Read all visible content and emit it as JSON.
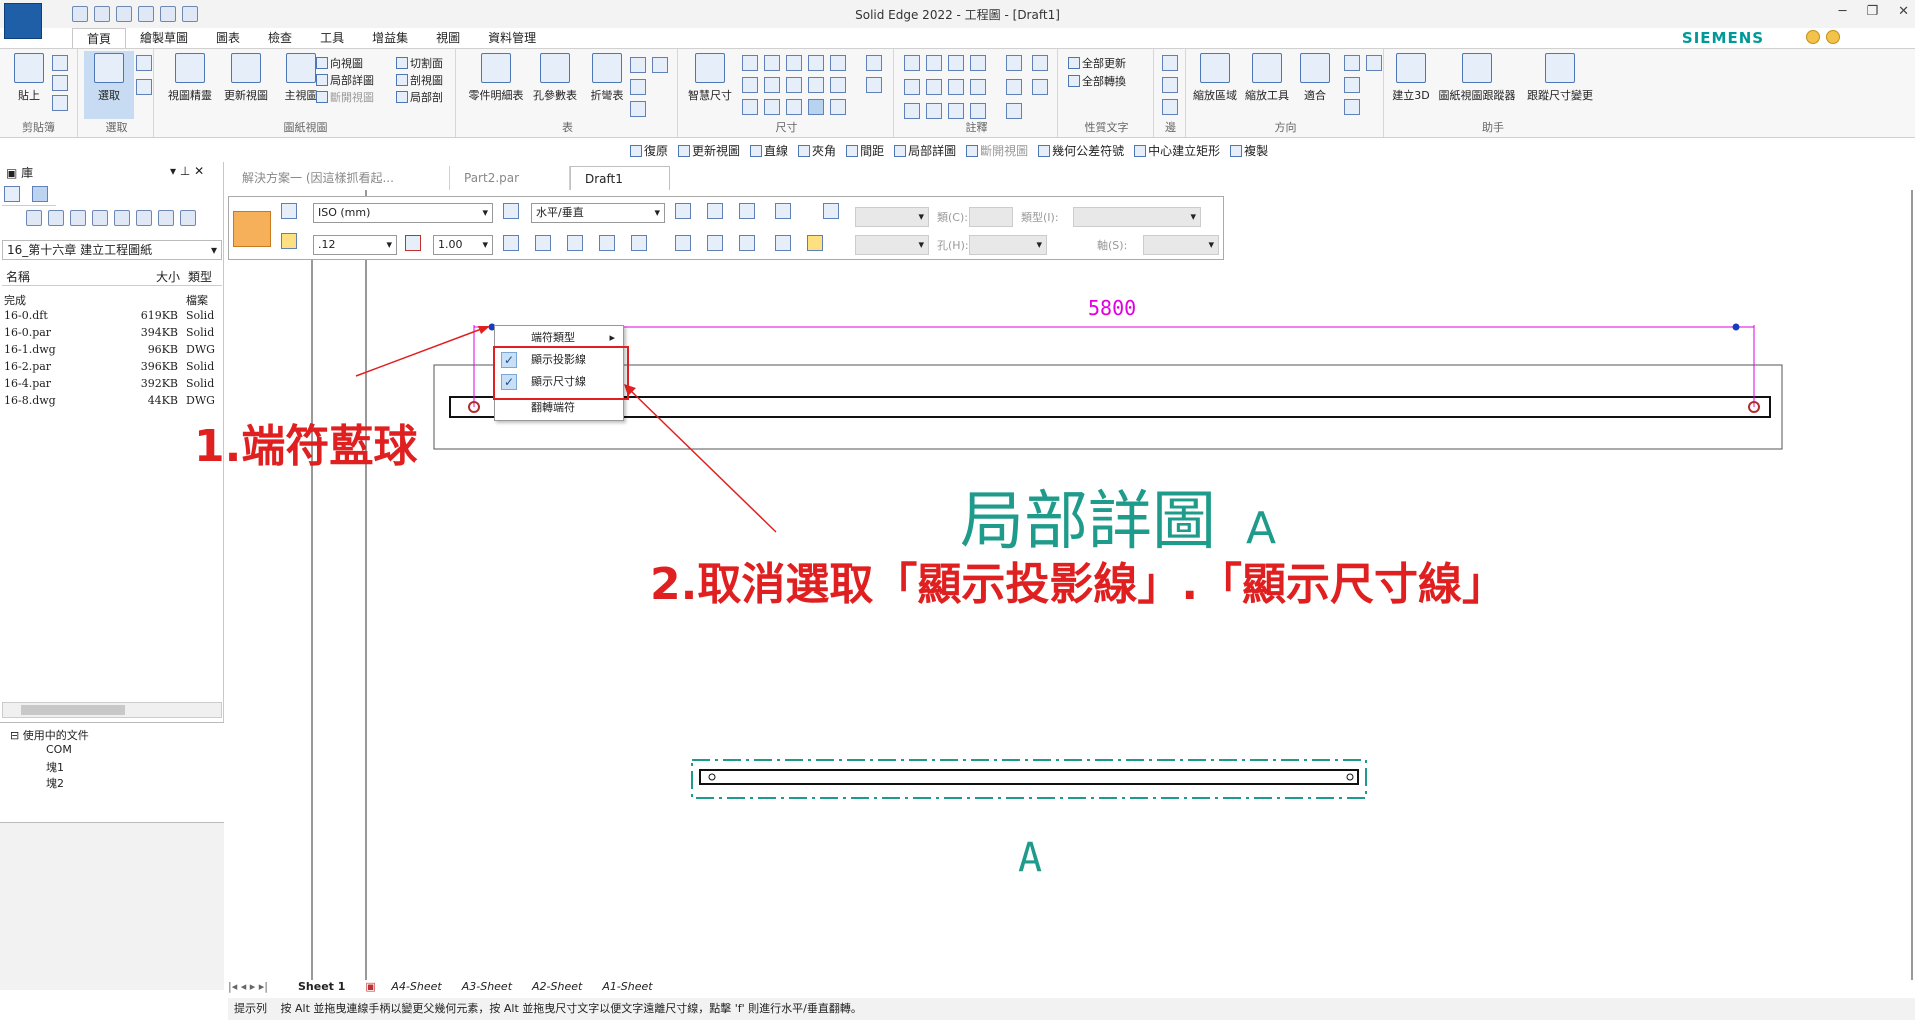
{
  "window": {
    "title": "Solid Edge 2022 - 工程圖 - [Draft1]"
  },
  "menu_tabs": [
    "首頁",
    "繪製草圖",
    "圖表",
    "檢查",
    "工具",
    "增益集",
    "視圖",
    "資料管理"
  ],
  "brand": "SIEMENS",
  "ribbon": {
    "clipboard": {
      "paste": "貼上",
      "label": "剪貼簿"
    },
    "select": {
      "select": "選取",
      "label": "選取"
    },
    "drawing_views": {
      "view_wizard": "視圖精靈",
      "update_views": "更新視圖",
      "principal": "主視圖",
      "projected": "向視圖",
      "detail": "局部詳圖",
      "broken": "斷開視圖",
      "cutting": "切割面",
      "section": "剖視圖",
      "broken_out": "局部剖",
      "label": "圖紙視圖"
    },
    "tables": {
      "parts_list": "零件明細表",
      "hole_table": "孔參數表",
      "bend_table": "折彎表",
      "label": "表"
    },
    "dimension": {
      "smart": "智慧尺寸",
      "label": "尺寸"
    },
    "annotation": {
      "label": "註釋"
    },
    "property_text": {
      "update_all": "全部更新",
      "convert_all": "全部轉換",
      "label": "性質文字"
    },
    "edges": {
      "label": "邊"
    },
    "orient": {
      "zoom_area": "縮放區域",
      "zoom": "縮放工具",
      "fit": "適合",
      "label": "方向"
    },
    "assist": {
      "create3d": "建立3D",
      "view_tracker": "圖紙視圖跟蹤器",
      "dim_tracker": "跟蹤尺寸變更",
      "label": "助手"
    }
  },
  "command_bar": [
    "復原",
    "更新視圖",
    "直線",
    "夾角",
    "間距",
    "局部詳圖",
    "斷開視圖",
    "幾何公差符號",
    "中心建立矩形",
    "複製"
  ],
  "left_pane": {
    "title": "庫",
    "folder": "16_第十六章 建立工程圖紙",
    "headers": {
      "name": "名稱",
      "size": "大小",
      "type": "類型"
    },
    "files": [
      {
        "name": "完成",
        "size": "",
        "type": "檔案"
      },
      {
        "name": "16-0.dft",
        "size": "619KB",
        "type": "Solid"
      },
      {
        "name": "16-0.par",
        "size": "394KB",
        "type": "Solid"
      },
      {
        "name": "16-1.dwg",
        "size": "96KB",
        "type": "DWG"
      },
      {
        "name": "16-2.par",
        "size": "396KB",
        "type": "Solid"
      },
      {
        "name": "16-4.par",
        "size": "392KB",
        "type": "Solid"
      },
      {
        "name": "16-8.dwg",
        "size": "44KB",
        "type": "DWG"
      }
    ],
    "tree": {
      "root": "使用中的文件",
      "items": [
        "COM",
        "塊1",
        "塊2"
      ]
    }
  },
  "doc_tabs": [
    "解決方案一 (因這樣抓看起...",
    "Part2.par",
    "Draft1"
  ],
  "dim_bar": {
    "standard": "ISO (mm)",
    "orientation": "水平/垂直",
    "precision": ".12",
    "scale": "1.00",
    "class_label": "類(C):",
    "type_label": "類型(I):",
    "hole_label": "孔(H):",
    "axis_label": "軸(S):"
  },
  "context_menu": {
    "terminator_type": "端符類型",
    "show_projection": "顯示投影線",
    "show_dimension": "顯示尺寸線",
    "flip": "翻轉端符"
  },
  "drawing": {
    "dimension_value": "5800",
    "detail_title": "局部詳圖",
    "detail_letter": "A",
    "view_label": "A"
  },
  "annotations": {
    "step1": "1.端符藍球",
    "step2": "2.取消選取「顯示投影線」.「顯示尺寸線」"
  },
  "sheets": [
    "Sheet 1",
    "A4-Sheet",
    "A3-Sheet",
    "A2-Sheet",
    "A1-Sheet"
  ],
  "status": {
    "label": "提示列",
    "text": "按 Alt 並拖曳連線手柄以變更父幾何元素，按 Alt 並拖曳尺寸文字以便文字遠離尺寸線，點擊 'f' 則進行水平/垂直翻轉。"
  }
}
